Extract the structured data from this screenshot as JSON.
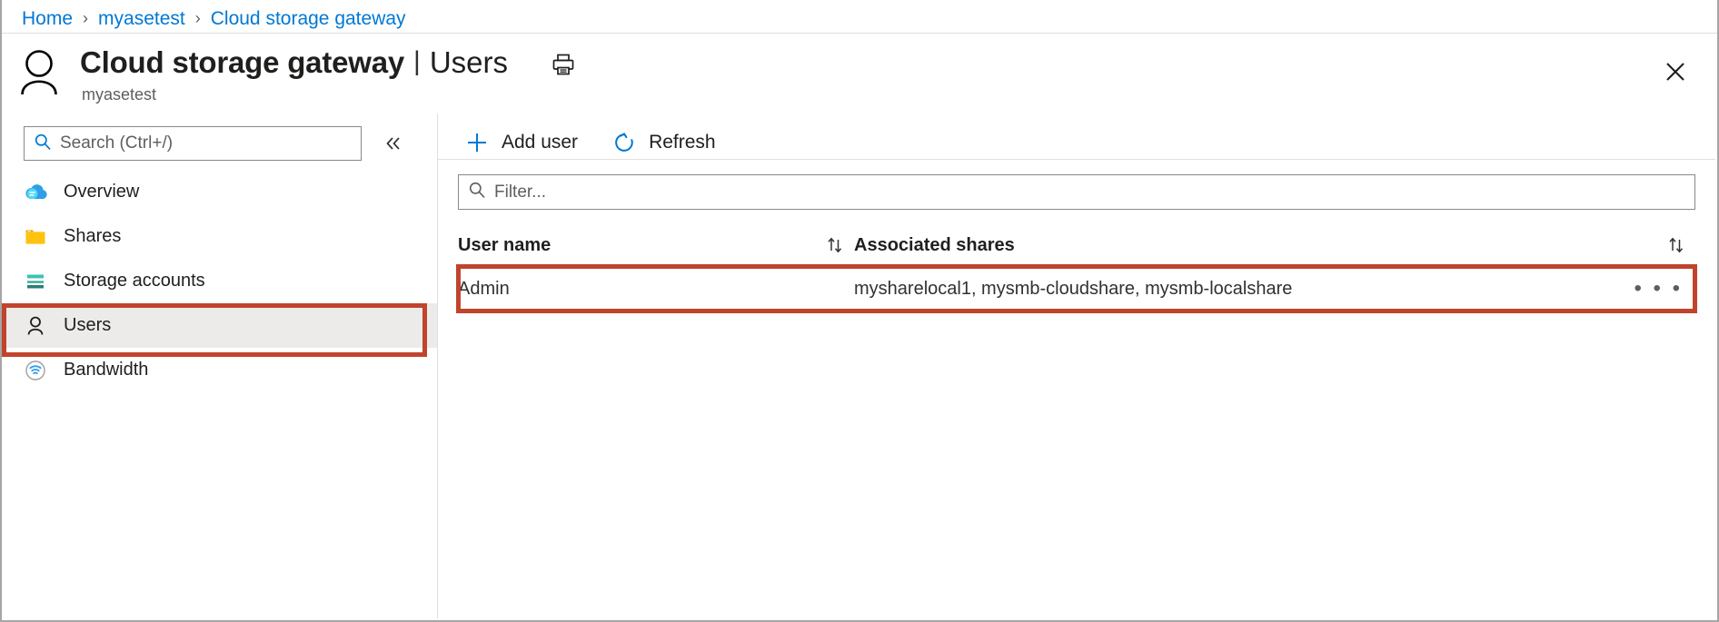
{
  "breadcrumb": {
    "items": [
      {
        "label": "Home"
      },
      {
        "label": "myasetest"
      },
      {
        "label": "Cloud storage gateway"
      }
    ],
    "separator": "›"
  },
  "header": {
    "avatar_icon": "user-avatar-icon",
    "title": "Cloud storage gateway",
    "divider": "|",
    "section": "Users",
    "subtitle": "myasetest",
    "print_icon": "print-icon",
    "close_icon": "close-icon"
  },
  "sidebar": {
    "search": {
      "placeholder": "Search (Ctrl+/)",
      "value": "",
      "icon": "search-icon"
    },
    "collapse_icon": "chevron-double-left-icon",
    "items": [
      {
        "label": "Overview",
        "icon": "cloud-icon",
        "selected": false
      },
      {
        "label": "Shares",
        "icon": "folder-icon",
        "selected": false
      },
      {
        "label": "Storage accounts",
        "icon": "storage-account-icon",
        "selected": false
      },
      {
        "label": "Users",
        "icon": "user-icon",
        "selected": true
      },
      {
        "label": "Bandwidth",
        "icon": "wifi-icon",
        "selected": false
      }
    ]
  },
  "toolbar": {
    "buttons": [
      {
        "label": "Add user",
        "icon": "plus-icon"
      },
      {
        "label": "Refresh",
        "icon": "refresh-icon"
      }
    ]
  },
  "filter": {
    "placeholder": "Filter...",
    "value": "",
    "icon": "search-icon"
  },
  "table": {
    "columns": [
      {
        "label": "User name",
        "sort_icon": "sort-arrows-icon"
      },
      {
        "label": "Associated shares",
        "sort_icon": "sort-arrows-icon"
      }
    ],
    "rows": [
      {
        "user_name": "Admin",
        "associated_shares": "mysharelocal1, mysmb-cloudshare, mysmb-localshare",
        "more_icon": "• • •"
      }
    ]
  },
  "highlights": {
    "color": "#c0442c",
    "targets": [
      "sidebar-item-users",
      "table-row-admin"
    ]
  }
}
